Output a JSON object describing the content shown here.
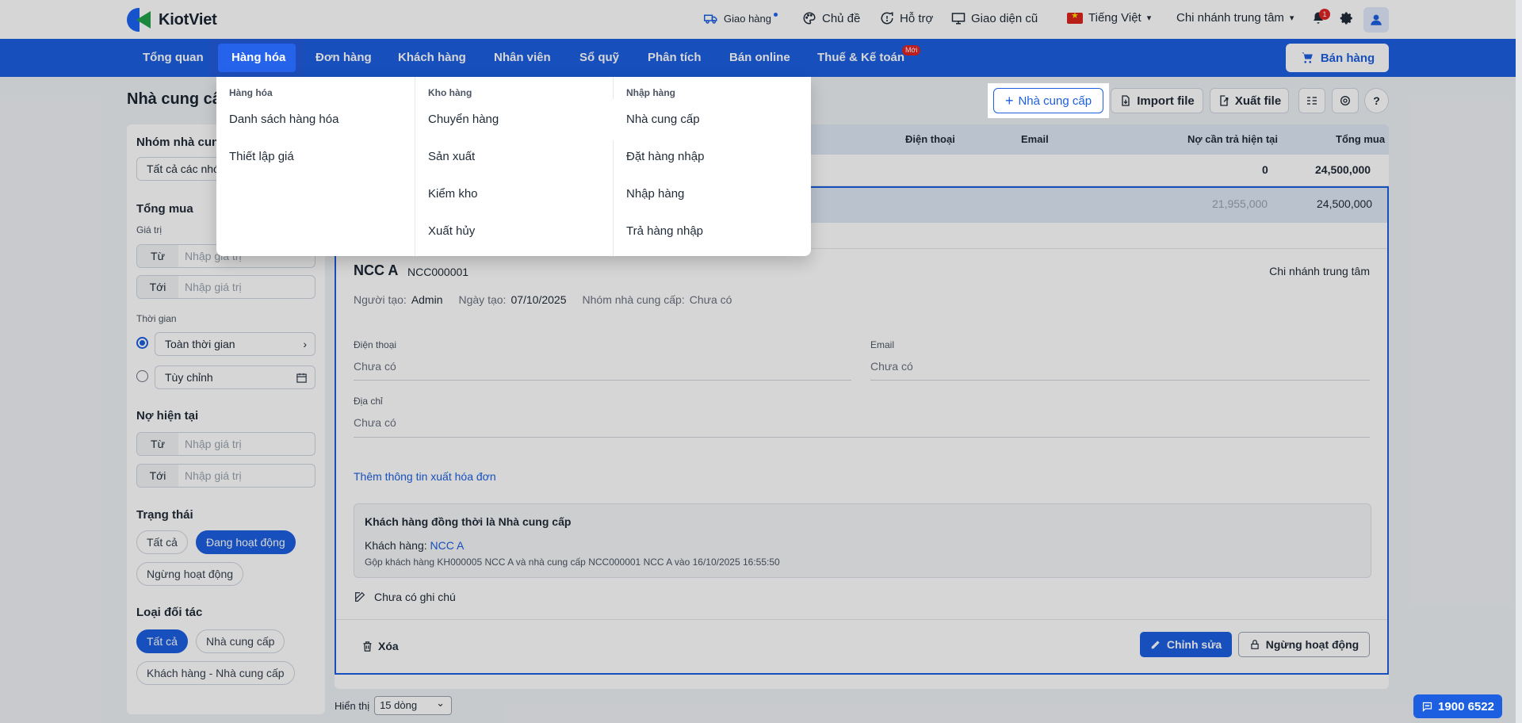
{
  "topbar": {
    "logo_text": "KiotViet",
    "delivery": "Giao hàng",
    "theme": "Chủ đề",
    "support": "Hỗ trợ",
    "old_ui": "Giao diện cũ",
    "language": "Tiếng Việt",
    "branch": "Chi nhánh trung tâm",
    "notification_count": "1"
  },
  "nav": {
    "items": [
      "Tổng quan",
      "Hàng hóa",
      "Đơn hàng",
      "Khách hàng",
      "Nhân viên",
      "Sổ quỹ",
      "Phân tích",
      "Bán online",
      "Thuế & Kế toán"
    ],
    "new_badge": "Mới",
    "sell_button": "Bán hàng"
  },
  "dropdown": {
    "columns": [
      {
        "heading": "Hàng hóa",
        "items": [
          "Danh sách hàng hóa",
          "Thiết lập giá"
        ]
      },
      {
        "heading": "Kho hàng",
        "items": [
          "Chuyển hàng",
          "Sản xuất",
          "Kiểm kho",
          "Xuất hủy"
        ]
      },
      {
        "heading": "Nhập hàng",
        "items": [
          "Nhà cung cấp",
          "Đặt hàng nhập",
          "Nhập hàng",
          "Trả hàng nhập"
        ]
      }
    ]
  },
  "page": {
    "title": "Nhà cung cấp",
    "add_button": "Nhà cung cấp",
    "import_button": "Import file",
    "export_button": "Xuất file"
  },
  "sidebar": {
    "group_title": "Nhóm nhà cung cấp",
    "group_select": "Tất cả các nhóm",
    "total_title": "Tổng mua",
    "value_label": "Giá trị",
    "from": "Từ",
    "to": "Tới",
    "placeholder": "Nhập giá trị",
    "time_label": "Thời gian",
    "time_all": "Toàn thời gian",
    "time_custom": "Tùy chỉnh",
    "debt_title": "Nợ hiện tại",
    "status_title": "Trạng thái",
    "status_all": "Tất cả",
    "status_active": "Đang hoạt động",
    "status_inactive": "Ngừng hoạt động",
    "partner_title": "Loại đối tác",
    "partner_all": "Tất cả",
    "partner_supplier": "Nhà cung cấp",
    "partner_customer_supplier": "Khách hàng - Nhà cung cấp"
  },
  "table": {
    "headers": {
      "phone": "Điện thoại",
      "email": "Email",
      "debt": "Nợ cần trả hiện tại",
      "total": "Tổng mua"
    },
    "summary": {
      "debt": "0",
      "total": "24,500,000"
    },
    "row": {
      "debt": "21,955,000",
      "total": "24,500,000"
    }
  },
  "detail": {
    "name": "NCC A",
    "code": "NCC000001",
    "branch": "Chi nhánh trung tâm",
    "creator_label": "Người tạo:",
    "creator": "Admin",
    "created_label": "Ngày tạo:",
    "created": "07/10/2025",
    "group_label": "Nhóm nhà cung cấp:",
    "group": "Chưa có",
    "phone_label": "Điện thoại",
    "phone": "Chưa có",
    "email_label": "Email",
    "email": "Chưa có",
    "address_label": "Địa chỉ",
    "address": "Chưa có",
    "invoice_link": "Thêm thông tin xuất hóa đơn",
    "merge_title": "Khách hàng đồng thời là Nhà cung cấp",
    "merge_customer_label": "Khách hàng:",
    "merge_customer": "NCC A",
    "merge_note": "Gộp khách hàng KH000005 NCC A và nhà cung cấp NCC000001 NCC A vào 16/10/2025 16:55:50",
    "no_note": "Chưa có ghi chú",
    "delete": "Xóa",
    "edit": "Chỉnh sửa",
    "deactivate": "Ngừng hoạt động"
  },
  "pager": {
    "label": "Hiển thị",
    "value": "15 dòng"
  },
  "hotline": "1900 6522"
}
